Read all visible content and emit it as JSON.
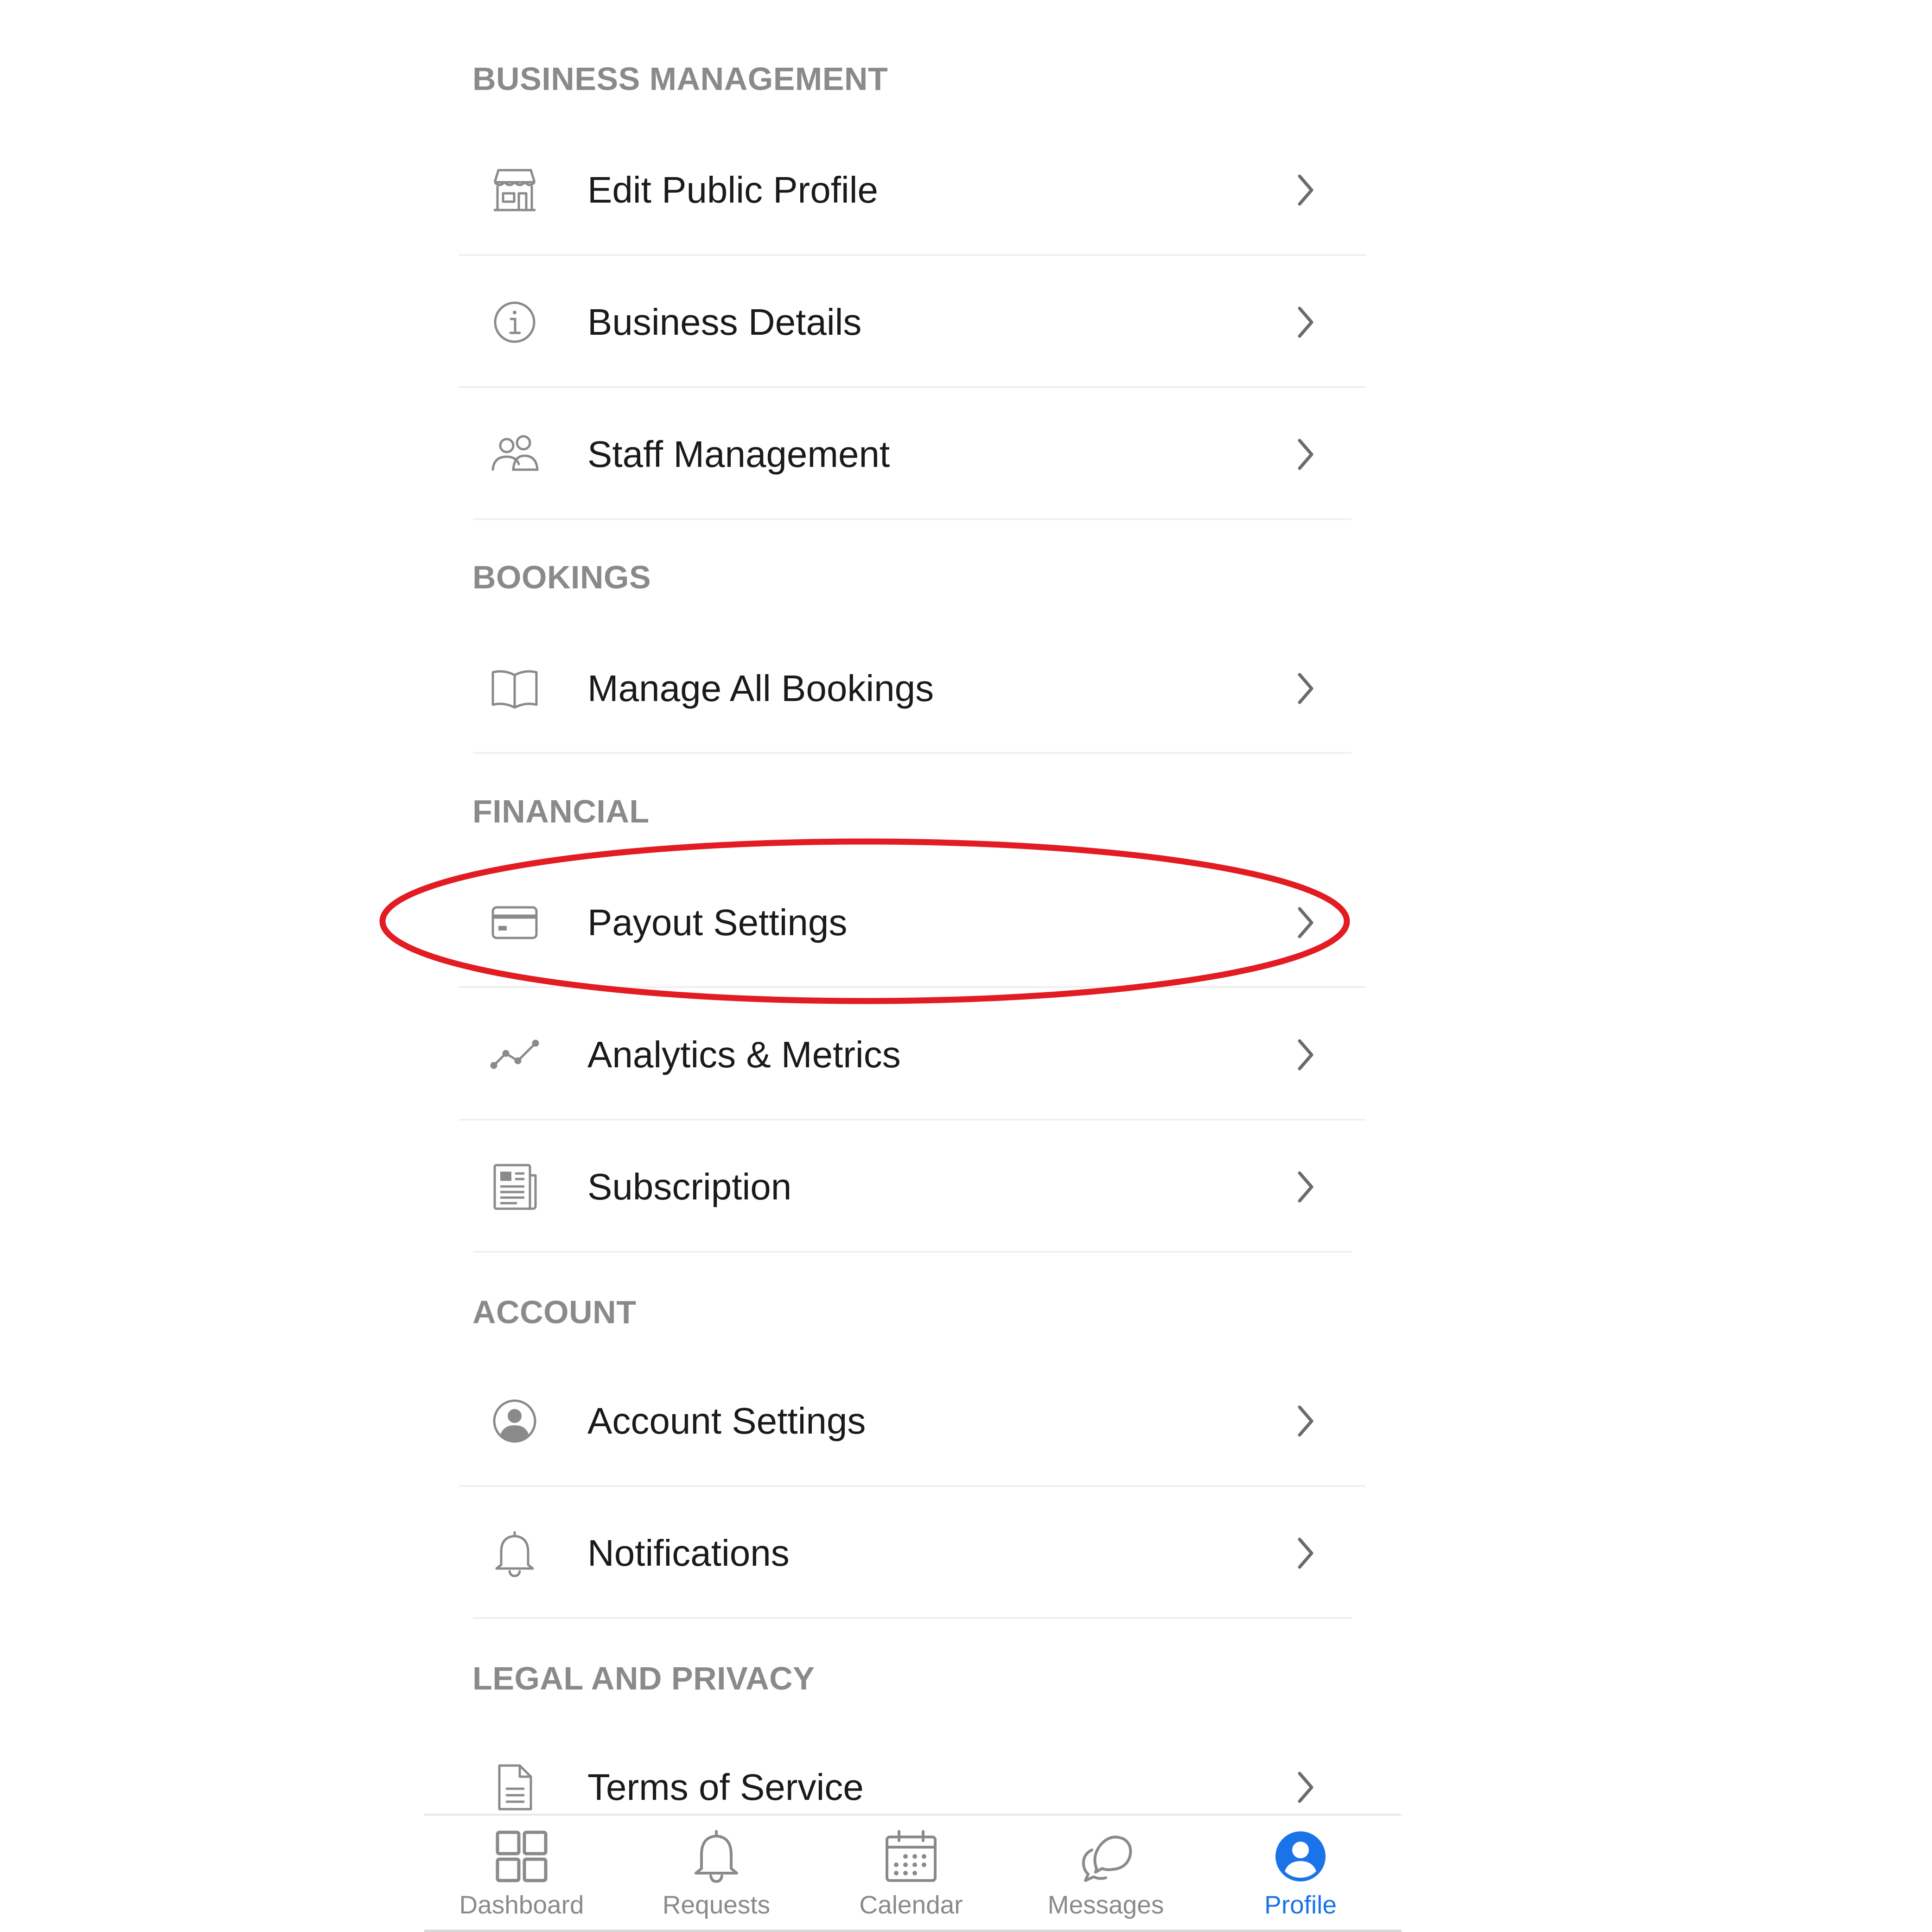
{
  "sections": {
    "business_management": {
      "title": "BUSINESS MANAGEMENT",
      "items": [
        {
          "label": "Edit Public Profile",
          "icon": "storefront-icon"
        },
        {
          "label": "Business Details",
          "icon": "info-icon"
        },
        {
          "label": "Staff Management",
          "icon": "people-icon"
        }
      ]
    },
    "bookings": {
      "title": "BOOKINGS",
      "items": [
        {
          "label": "Manage All Bookings",
          "icon": "book-open-icon"
        }
      ]
    },
    "financial": {
      "title": "FINANCIAL",
      "items": [
        {
          "label": "Payout Settings",
          "icon": "credit-card-icon"
        },
        {
          "label": "Analytics & Metrics",
          "icon": "line-chart-icon"
        },
        {
          "label": "Subscription",
          "icon": "newspaper-icon"
        }
      ]
    },
    "account": {
      "title": "ACCOUNT",
      "items": [
        {
          "label": "Account Settings",
          "icon": "user-circle-icon"
        },
        {
          "label": "Notifications",
          "icon": "bell-icon"
        }
      ]
    },
    "legal_and_privacy": {
      "title": "LEGAL AND PRIVACY",
      "items": [
        {
          "label": "Terms of Service",
          "icon": "document-icon"
        }
      ]
    }
  },
  "annotation": {
    "highlighted_item": "Payout Settings",
    "color": "#e31b23"
  },
  "tab_bar": {
    "active": "Profile",
    "active_color": "#1a73e8",
    "inactive_color": "#8a8a8a",
    "tabs": [
      {
        "label": "Dashboard",
        "icon": "grid-icon"
      },
      {
        "label": "Requests",
        "icon": "bell-icon"
      },
      {
        "label": "Calendar",
        "icon": "calendar-icon"
      },
      {
        "label": "Messages",
        "icon": "chat-bubbles-icon"
      },
      {
        "label": "Profile",
        "icon": "user-profile-icon"
      }
    ]
  }
}
